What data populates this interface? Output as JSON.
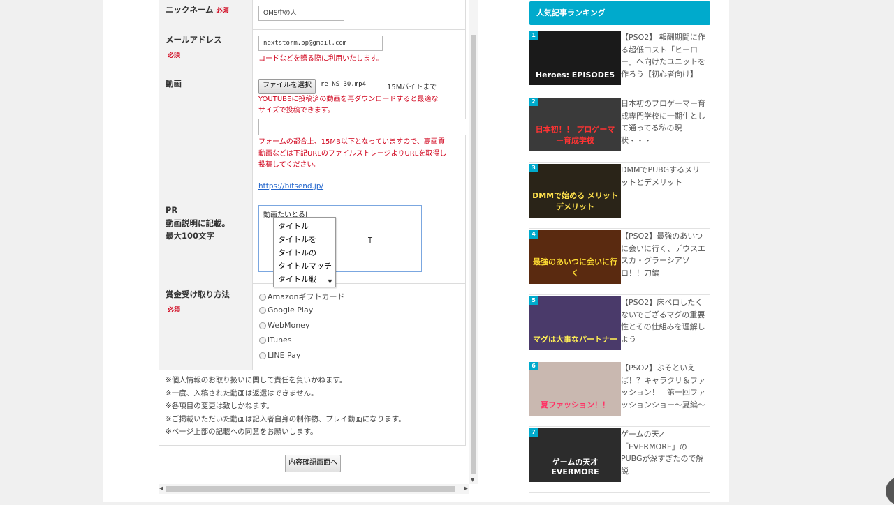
{
  "form": {
    "nickname": {
      "label": "ニックネーム",
      "required": "必須",
      "value": "OMS中の人"
    },
    "email": {
      "label": "メールアドレス",
      "required": "必須",
      "value": "nextstorm.bp@gmail.com",
      "note": "コードなどを贈る際に利用いたします。"
    },
    "video": {
      "label": "動画",
      "button": "ファイルを選択",
      "filename": "re NS 30.mp4",
      "limit": "15Mバイトまで",
      "note1_line1": "YOUTUBEに投稿済の動画を再ダウンロードすると最適な",
      "note1_line2": "サイズで投稿できます。",
      "url_value": "",
      "note2_line1": "フォームの都合上、15MB以下となっていますので、高画質",
      "note2_line2": "動画などは下記URLのファイルストレージよりURLを取得し",
      "note2_line3": "投稿してください。",
      "link": "https://bitsend.jp/"
    },
    "pr": {
      "label_line1": "PR",
      "label_line2": "動画説明に記載。",
      "label_line3": "最大100文字",
      "value": "動画たいとる|",
      "suggestions": [
        "タイトル",
        "タイトルを",
        "タイトルの",
        "タイトルマッチ",
        "タイトル戦"
      ]
    },
    "reward": {
      "label": "賞金受け取り方法",
      "required": "必須",
      "options": [
        "Amazonギフトカード",
        "Google Play",
        "WebMoney",
        "iTunes",
        "LINE Pay"
      ]
    },
    "notes": [
      "※個人情報のお取り扱いに関して責任を負いかねます。",
      "※一度、入稿された動画は返還はできません。",
      "※各項目の変更は致しかねます。",
      "※ご掲載いただいた動画は記入者自身の制作物、プレイ動画になります。",
      "※ページ上部の記載への同意をお願いします。"
    ],
    "confirm_button": "内容確認画面へ"
  },
  "sidebar": {
    "header": "人気記事ランキング",
    "items": [
      {
        "rank": "1",
        "title_lines": [
          "【PSO2】 報酬期間に作",
          "る超低コスト「ヒーロ",
          "ー」へ向けたユニットを",
          "作ろう【初心者向け】"
        ],
        "thumb_caption": "Heroes: EPISODE5",
        "thumb_bg": "#1a1a1a",
        "cap_color": "#ffffff"
      },
      {
        "rank": "2",
        "title_lines": [
          "日本初のプロゲーマー育",
          "成専門学校に一期生とし",
          "て通ってる私の現",
          "状・・・"
        ],
        "thumb_caption": "日本初！！ プロゲーマー育成学校",
        "thumb_bg": "#3a3a3a",
        "cap_color": "#ff3333"
      },
      {
        "rank": "3",
        "title_lines": [
          "DMMでPUBGするメリ",
          "ットとデメリット"
        ],
        "thumb_caption": "DMMで始める メリットデメリット",
        "thumb_bg": "#2a2418",
        "cap_color": "#ffe14d"
      },
      {
        "rank": "4",
        "title_lines": [
          "【PSO2】最強のあいつ",
          "に会いに行く、デウスエ",
          "スカ・グラーシアソ",
          "ロ！！刀編"
        ],
        "thumb_caption": "最強のあいつに会いに行く",
        "thumb_bg": "#5a2a10",
        "cap_color": "#ffdd33"
      },
      {
        "rank": "5",
        "title_lines": [
          "【PSO2】床ペロしたく",
          "ないでござるマグの重要",
          "性とその仕組みを理解し",
          "よう"
        ],
        "thumb_caption": "マグは大事なパートナー",
        "thumb_bg": "#4a3a6a",
        "cap_color": "#ffee55"
      },
      {
        "rank": "6",
        "title_lines": [
          "【PSO2】ぶそといえ",
          "ば！？キャラクリ＆ファ",
          "ッション！　第一回ファ",
          "ッションショー〜夏編〜"
        ],
        "thumb_caption": "夏ファッション！！",
        "thumb_bg": "#c9b8b0",
        "cap_color": "#ff3366"
      },
      {
        "rank": "7",
        "title_lines": [
          "ゲームの天才",
          "「EVERMORE」の",
          "PUBGが深すぎたので解",
          "説"
        ],
        "thumb_caption": "ゲームの天才 EVERMORE",
        "thumb_bg": "#2c2c2c",
        "cap_color": "#ffffff"
      }
    ]
  }
}
